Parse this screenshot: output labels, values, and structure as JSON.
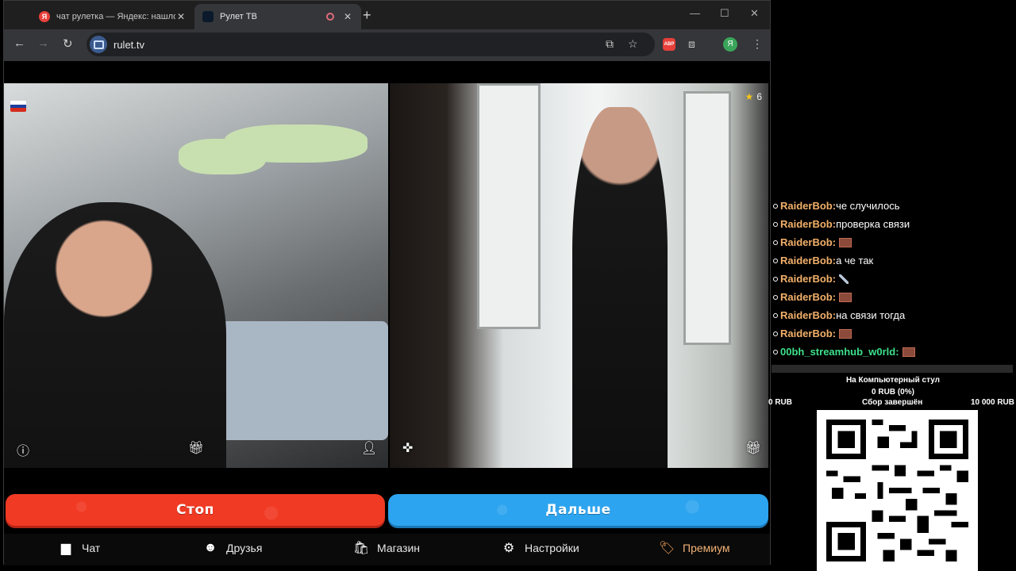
{
  "browser": {
    "tabs": [
      {
        "title": "чат рулетка — Яндекс: нашлось",
        "favicon": "Я",
        "close": "✕"
      },
      {
        "title": "Рулет ТВ",
        "close": "✕"
      }
    ],
    "new_tab": "+",
    "url": "rulet.tv",
    "profile_initial": "Я",
    "abp_label": "ABP"
  },
  "page": {
    "viewer_count": "6",
    "buttons": {
      "stop": "Стоп",
      "next": "Дальше"
    },
    "nav": [
      {
        "label": "Чат",
        "icon": "chat-icon"
      },
      {
        "label": "Друзья",
        "icon": "friends-icon"
      },
      {
        "label": "Магазин",
        "icon": "shop-icon"
      },
      {
        "label": "Настройки",
        "icon": "settings-icon"
      },
      {
        "label": "Премиум",
        "icon": "premium-icon"
      }
    ]
  },
  "chat": [
    {
      "user": "RaiderBob:",
      "text": "че случилось"
    },
    {
      "user": "RaiderBob:",
      "text": "проверка связи"
    },
    {
      "user": "RaiderBob:",
      "text": "",
      "emote": "brick"
    },
    {
      "user": "RaiderBob:",
      "text": "а че так"
    },
    {
      "user": "RaiderBob:",
      "text": "",
      "emote": "knife"
    },
    {
      "user": "RaiderBob:",
      "text": "",
      "emote": "brick"
    },
    {
      "user": "RaiderBob:",
      "text": "на связи тогда"
    },
    {
      "user": "RaiderBob:",
      "text": "",
      "emote": "brick"
    },
    {
      "user": "00bh_streamhub_w0rld:",
      "text": "",
      "emote": "brick"
    }
  ],
  "donation": {
    "title": "На Компьютерный стул",
    "sum": "0 RUB (0%)",
    "min": "0 RUB",
    "status": "Сбор завершён",
    "goal": "10 000 RUB"
  },
  "colors": {
    "stop": "#f03a24",
    "next": "#2da4ef",
    "chat_user": "#f2b06a",
    "chat_user_alt": "#3ee08a",
    "premium": "#f2b277"
  }
}
